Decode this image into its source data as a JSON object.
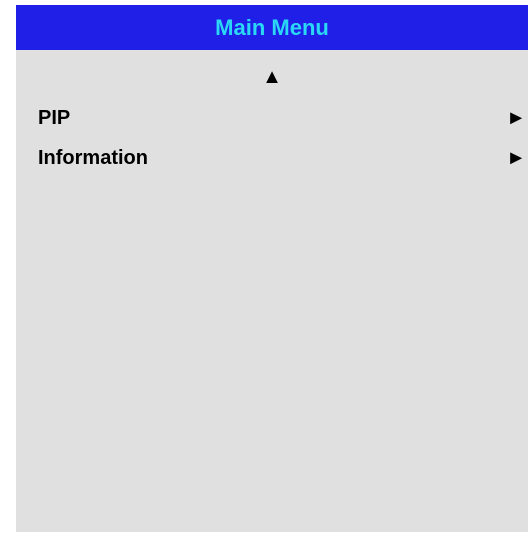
{
  "menu": {
    "title": "Main Menu",
    "scroll_up_glyph": "▲",
    "items": [
      {
        "label": "PIP",
        "arrow_glyph": "►",
        "icon": "arrow-right-icon"
      },
      {
        "label": "Information",
        "arrow_glyph": "►",
        "icon": "arrow-right-icon"
      }
    ]
  },
  "colors": {
    "header_background": "#1f1fe8",
    "header_text": "#2ad8f5",
    "menu_background": "#e0e0e0",
    "item_text": "#000000"
  }
}
